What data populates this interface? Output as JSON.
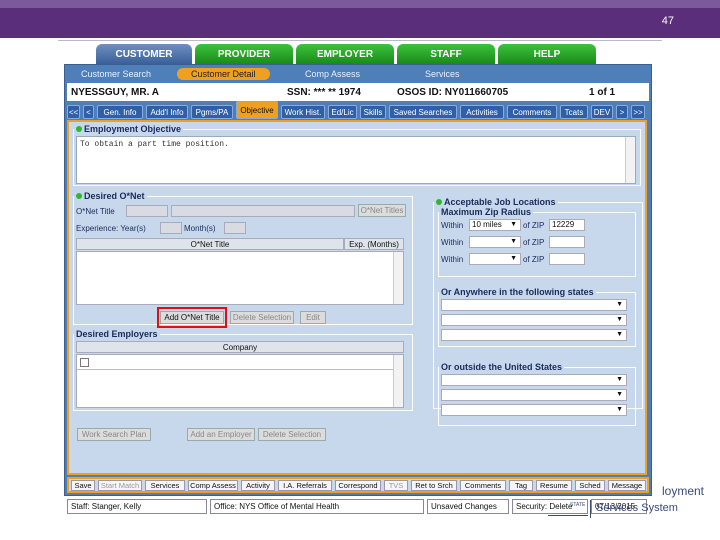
{
  "slide_number": "47",
  "tabs": [
    "CUSTOMER",
    "PROVIDER",
    "EMPLOYER",
    "STAFF",
    "HELP"
  ],
  "subnav": [
    "Customer Search",
    "Customer Detail",
    "Comp Assess",
    "Services"
  ],
  "customer": {
    "name": "NYESSGUY, MR. A",
    "ssn": "SSN: *** ** 1974",
    "osos_id": "OSOS ID: NY011660705",
    "record": "1 of 1"
  },
  "subtabs": [
    "<<",
    "<",
    "Gen. Info",
    "Add'l Info",
    "Pgms/PA",
    "Objective",
    "Work Hist.",
    "Ed/Lic",
    "Skills",
    "Saved Searches",
    "Activities",
    "Comments",
    "Tcats",
    "DEV",
    ">",
    ">>"
  ],
  "employment_objective": {
    "legend": "Employment Objective",
    "text": "To obtain a part time position."
  },
  "desired_onet": {
    "legend": "Desired O*Net",
    "onet_title_label": "O*Net Title",
    "onet_titles_button": "O*Net Titles",
    "experience_label": "Experience: Year(s)",
    "months_label": "Month(s)",
    "col_title": "O*Net Title",
    "col_exp": "Exp. (Months)",
    "add_button": "Add O*Net Title",
    "delete_button": "Delete Selection",
    "edit_button": "Edit"
  },
  "job_locations": {
    "legend": "Acceptable Job Locations",
    "zip_radius_legend": "Maximum Zip Radius",
    "rows": [
      {
        "within": "Within",
        "miles": "10 miles",
        "of_zip": "of ZIP",
        "zip": "12229"
      },
      {
        "within": "Within",
        "miles": "",
        "of_zip": "of ZIP",
        "zip": ""
      },
      {
        "within": "Within",
        "miles": "",
        "of_zip": "of ZIP",
        "zip": ""
      }
    ],
    "anywhere_legend": "Or Anywhere in the following states",
    "outside_legend": "Or outside the United States"
  },
  "desired_employers": {
    "legend": "Desired Employers",
    "col_company": "Company"
  },
  "left_buttons": {
    "work_search_plan": "Work Search Plan",
    "add_employer": "Add an Employer",
    "delete_selection": "Delete Selection"
  },
  "bottom_buttons": [
    "Save",
    "Start Match",
    "Services",
    "Comp Assess",
    "Activity",
    "I.A. Referrals",
    "Correspond",
    "TVS",
    "Ret to Srch",
    "Comments",
    "Tag",
    "Resume",
    "Sched",
    "Message"
  ],
  "status": {
    "staff": "Staff: Stanger, Kelly",
    "office": "Office: NYS Office of Mental Health",
    "unsaved": "Unsaved Changes",
    "security": "Security: Delete",
    "date": "07/13/2015"
  },
  "logo": {
    "line1": "loyment",
    "line2": "Services System",
    "small": "STATE"
  },
  "colors": {
    "accent": "#f0a020",
    "header": "#5a2e7a",
    "panel": "#4f7fb8",
    "tab_green": "#2db82d",
    "highlight": "#dd1111"
  }
}
